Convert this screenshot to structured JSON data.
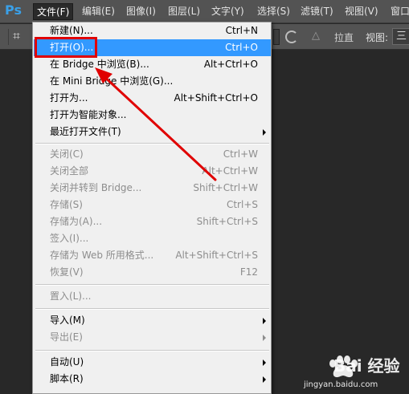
{
  "app": {
    "logo": "Ps"
  },
  "menubar": {
    "items": [
      {
        "label": "文件(F)"
      },
      {
        "label": "编辑(E)"
      },
      {
        "label": "图像(I)"
      },
      {
        "label": "图层(L)"
      },
      {
        "label": "文字(Y)"
      },
      {
        "label": "选择(S)"
      },
      {
        "label": "滤镜(T)"
      },
      {
        "label": "视图(V)"
      },
      {
        "label": "窗口"
      }
    ]
  },
  "optionsbar": {
    "straighten": "拉直",
    "view_label": "视图:",
    "view_value": "三"
  },
  "file_menu": {
    "items": [
      {
        "label": "新建(N)...",
        "shortcut": "Ctrl+N",
        "enabled": true
      },
      {
        "label": "打开(O)...",
        "shortcut": "Ctrl+O",
        "enabled": true,
        "highlighted": true
      },
      {
        "label": "在 Bridge 中浏览(B)...",
        "shortcut": "Alt+Ctrl+O",
        "enabled": true
      },
      {
        "label": "在 Mini Bridge 中浏览(G)...",
        "shortcut": "",
        "enabled": true
      },
      {
        "label": "打开为...",
        "shortcut": "Alt+Shift+Ctrl+O",
        "enabled": true
      },
      {
        "label": "打开为智能对象...",
        "shortcut": "",
        "enabled": true
      },
      {
        "label": "最近打开文件(T)",
        "shortcut": "",
        "enabled": true,
        "submenu": true
      },
      {
        "label": "关闭(C)",
        "shortcut": "Ctrl+W",
        "enabled": false
      },
      {
        "label": "关闭全部",
        "shortcut": "Alt+Ctrl+W",
        "enabled": false
      },
      {
        "label": "关闭并转到 Bridge...",
        "shortcut": "Shift+Ctrl+W",
        "enabled": false
      },
      {
        "label": "存储(S)",
        "shortcut": "Ctrl+S",
        "enabled": false
      },
      {
        "label": "存储为(A)...",
        "shortcut": "Shift+Ctrl+S",
        "enabled": false
      },
      {
        "label": "签入(I)...",
        "shortcut": "",
        "enabled": false
      },
      {
        "label": "存储为 Web 所用格式...",
        "shortcut": "Alt+Shift+Ctrl+S",
        "enabled": false
      },
      {
        "label": "恢复(V)",
        "shortcut": "F12",
        "enabled": false
      },
      {
        "label": "置入(L)...",
        "shortcut": "",
        "enabled": false
      },
      {
        "label": "导入(M)",
        "shortcut": "",
        "enabled": true,
        "submenu": true
      },
      {
        "label": "导出(E)",
        "shortcut": "",
        "enabled": false,
        "submenu": true
      },
      {
        "label": "自动(U)",
        "shortcut": "",
        "enabled": true,
        "submenu": true
      },
      {
        "label": "脚本(R)",
        "shortcut": "",
        "enabled": true,
        "submenu": true
      }
    ]
  },
  "watermark": {
    "brand": "Bai 经验",
    "url": "jingyan.baidu.com"
  },
  "colors": {
    "highlight": "#3399ff",
    "annotation": "#e00000",
    "ps_logo": "#3aa0e8"
  }
}
